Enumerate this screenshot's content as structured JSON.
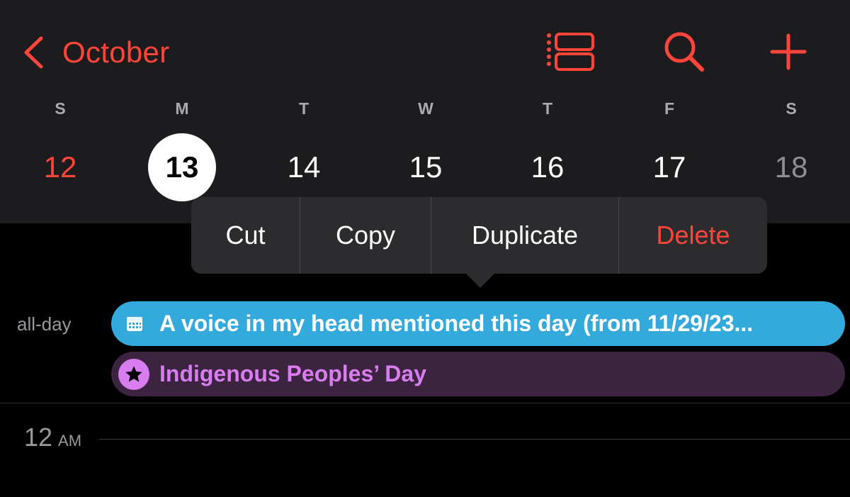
{
  "header": {
    "back_label": "October",
    "icons": [
      "chevron-left-icon",
      "list-view-icon",
      "search-icon",
      "plus-icon"
    ],
    "accent_color": "#ff453a"
  },
  "week": {
    "weekdays": [
      "S",
      "M",
      "T",
      "W",
      "T",
      "F",
      "S"
    ],
    "days": [
      "12",
      "13",
      "14",
      "15",
      "16",
      "17",
      "18"
    ],
    "selected_day": "13"
  },
  "context_menu": {
    "items": [
      "Cut",
      "Copy",
      "Duplicate",
      "Delete"
    ]
  },
  "allday": {
    "label": "all-day",
    "events": [
      {
        "title": "A voice in my head mentioned this day (from 11/29/23...",
        "color": "#34aadc",
        "icon": "calendar-icon"
      },
      {
        "title": "Indigenous Peoples’ Day",
        "color": "#d87cf0",
        "icon": "star-icon"
      }
    ]
  },
  "timeline": {
    "hour": "12",
    "ampm": "AM"
  }
}
